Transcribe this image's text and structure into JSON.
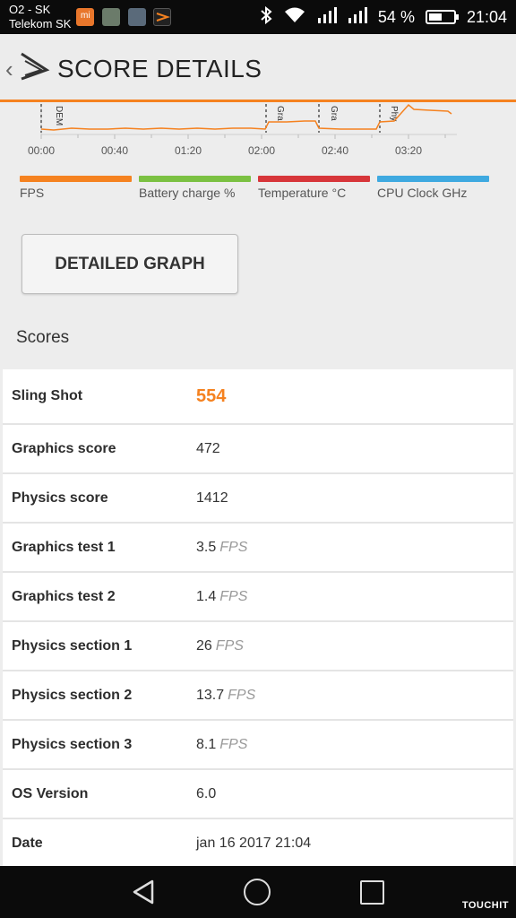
{
  "status_bar": {
    "carrier_1": "O2 - SK",
    "carrier_2": "Telekom SK",
    "battery_percent": "54 %",
    "battery_level": 0.54,
    "time": "21:04",
    "icons": [
      "mi-icon",
      "photo-icon",
      "gallery-icon",
      "3dmark-icon",
      "bluetooth-icon",
      "wifi-icon",
      "signal-icon",
      "signal-icon",
      "battery-icon"
    ]
  },
  "header": {
    "title": "SCORE DETAILS",
    "back_icon": "chevron-left-icon",
    "logo_icon": "3dmark-logo-icon"
  },
  "graph": {
    "x_ticks": [
      "00:00",
      "00:40",
      "01:20",
      "02:00",
      "02:40",
      "03:20"
    ],
    "markers": [
      "DEM",
      "Gra",
      "Gra",
      "Phy"
    ],
    "legend": [
      {
        "label": "FPS",
        "color": "#f58220"
      },
      {
        "label": "Battery charge %",
        "color": "#7bc142"
      },
      {
        "label": "Temperature °C",
        "color": "#d7363a"
      },
      {
        "label": "CPU Clock GHz",
        "color": "#3fa9e0"
      }
    ]
  },
  "detailed_graph_button": "DETAILED GRAPH",
  "scores_heading": "Scores",
  "scores": [
    {
      "label": "Sling Shot",
      "value": "554",
      "unit": ""
    },
    {
      "label": "Graphics score",
      "value": "472",
      "unit": ""
    },
    {
      "label": "Physics score",
      "value": "1412",
      "unit": ""
    },
    {
      "label": "Graphics test 1",
      "value": "3.5",
      "unit": "FPS"
    },
    {
      "label": "Graphics test 2",
      "value": "1.4",
      "unit": "FPS"
    },
    {
      "label": "Physics section 1",
      "value": "26",
      "unit": "FPS"
    },
    {
      "label": "Physics section 2",
      "value": "13.7",
      "unit": "FPS"
    },
    {
      "label": "Physics section 3",
      "value": "8.1",
      "unit": "FPS"
    },
    {
      "label": "OS Version",
      "value": "6.0",
      "unit": ""
    },
    {
      "label": "Date",
      "value": "jan 16 2017 21:04",
      "unit": ""
    }
  ],
  "watermark": "TOUCHIT"
}
